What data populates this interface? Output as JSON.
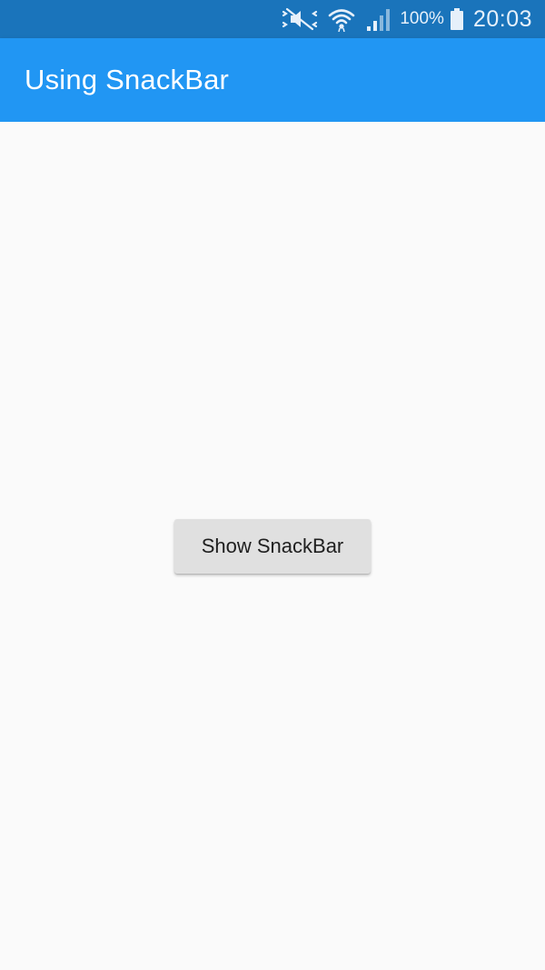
{
  "status_bar": {
    "icons": [
      "mute-vibrate-icon",
      "wifi-icon",
      "signal-icon",
      "battery-icon"
    ],
    "battery_percent": "100%",
    "time": "20:03"
  },
  "app_bar": {
    "title": "Using SnackBar",
    "color": "#2196f3"
  },
  "main": {
    "button_label": "Show SnackBar"
  },
  "colors": {
    "status_bar": "#1a74bb",
    "app_bar": "#2196f3",
    "background": "#fafafa",
    "button": "#e0e0e0"
  }
}
